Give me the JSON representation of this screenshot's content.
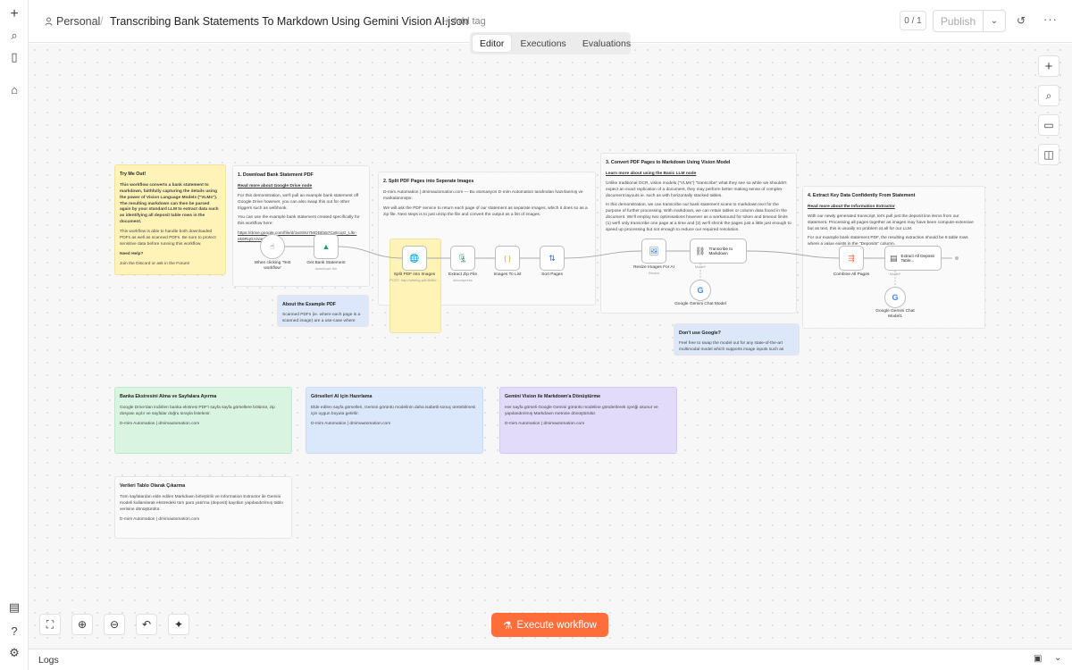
{
  "rail": {
    "add_icon": "+",
    "search_icon": "⌕",
    "panel_icon": "▯",
    "home_icon": "⌂",
    "insights_icon": "▤",
    "help_icon": "?",
    "settings_icon": "⚙"
  },
  "header": {
    "project": "Personal",
    "separator": "/",
    "workflow_title": "Transcribing Bank Statements To Markdown Using Gemini Vision AI.json",
    "add_tag": "+ Add tag",
    "counter": "0 / 1",
    "publish_label": "Publish",
    "publish_caret": "⌄",
    "history_icon": "↺",
    "more_icon": "···"
  },
  "tabs": [
    {
      "label": "Editor",
      "active": true
    },
    {
      "label": "Executions",
      "active": false
    },
    {
      "label": "Evaluations",
      "active": false
    }
  ],
  "canvas_tools": {
    "add_node_icon": "+",
    "search_icon": "⌕",
    "sticky_icon": "▭",
    "panel_icon": "◫"
  },
  "stickies": {
    "try_me": {
      "heading": "Try Me Out!",
      "body1": "This workflow converts a bank statement to markdown, faithfully capturing the details using the power of Vision Language Models (\"VLMs\"). The resulting markdown can then be parsed again by your standard LLM to extract data such as identifying all deposit table rows in the document.",
      "body2": "This workflow is able to handle both downloaded PDFs as well as scanned PDFs. Be sure to protect sensitive data before running this workflow.",
      "help_heading": "Need Help?",
      "help_body": "Join the Discord or ask in the Forum!"
    },
    "download": {
      "heading": "1. Download Bank Statement PDF",
      "link": "Read more about Google Drive node",
      "body1": "For this demonstration, we'll pull an example bank statement off Google Drive however, you can also swap this out for other triggers such as webhook.",
      "body2": "You can use the example bank statement created specifically for this workflow here:",
      "url": "https://drive.google.com/file/d/1wS9U7MQDthj57CvEcqG_Llkr-ek6RqGA/view"
    },
    "split": {
      "heading": "2. Split PDF Pages into Seperate Images",
      "body1": "D-mim Automation | dmimautomation.com — Bu otomasyon D-mim Automation tarafından hazırlanmış ve markalanmıştır.",
      "body2": "We will ask the PDF service to return each page of our statement as separate images, which it does so as a zip file. Next steps is to just unzip the file and convert the output as a list of images."
    },
    "convert": {
      "heading": "3. Convert PDF Pages to Markdown Using Vision Model",
      "link": "Learn more about using the Basic LLM node",
      "body1": "Unlike traditional OCR, vision models (\"VLMs\") \"transcribe\" what they see so while we shouldn't expect an exact replication of a document, they may perform better making sense of complex document layouts ie. such as with horizontally stacked tables.",
      "body2": "In this demonstration, we can transcribe our bank statement scans to markdown text for the purpose of further processing. With markdown, we can retain tables or column data found in the document. We'll employ two optimisations however as a workaround for token and timeout limits (1) we'll only transcribe one page at a time and (2) we'll shrink the pages just a little just enough to speed up processing but not enough to reduce our required resolution."
    },
    "extract": {
      "heading": "4. Extract Key Data Confidently From Statement",
      "link": "Read more about the Information Extractor",
      "body1": "With our newly generated transcript, let's pull just the deposit line items from our statement. Processing all pages together as images may have been compute-extensive but as text, this is usually no problem at all for our LLM.",
      "body2": "For our example bank statement PDF, the resulting extraction should be 8 table rows where a value exists in the \"Deposits\" column."
    },
    "about_pdf": {
      "heading": "About the Example PDF",
      "body": "Scanned PDFs (ie. where each page is a scanned image) are a use-case where"
    },
    "dont_google": {
      "heading": "Don't use Google?",
      "body": "Feel free to swap the model out for any state-of-the-art multimodal model which supports image inputs such as"
    },
    "tr1": {
      "heading": "Banka Ekstresini Alma ve Sayfalara Ayırma",
      "body": "Google Drive'dan indirilen banka ekstresi PDF'i sayfa sayfa görsellere bölünür, zip dosyası açılır ve sayfalar doğru sırayla listelenir.",
      "brand": "D-mim Automation | dmimautomation.com"
    },
    "tr2": {
      "heading": "Görselleri AI için Hazırlama",
      "body": "Elde edilen sayfa görselleri, Gemini görüntü modelinin daha isabetli sonuç üretebilmesi için uygun boyuta getirilir.",
      "brand": "D-mim Automation | dmimautomation.com"
    },
    "tr3": {
      "heading": "Gemini Vision ile Markdown'a Dönüştürme",
      "body": "Her sayfa görseli Google Gemini görüntü modeline gönderilerek içeriği okunur ve yapılandırılmış Markdown metnine dönüştürülür.",
      "brand": "D-mim Automation | dmimautomation.com"
    },
    "tr4": {
      "heading": "Verileri Tablo Olarak Çıkarma",
      "body": "Tüm sayfalardan elde edilen Markdown birleştirilir ve Information Extractor ile Gemini modeli kullanılarak ekstredeki tüm para yatırma (deposit) kayıtları yapılandırılmış tablo verisine dönüştürülür.",
      "brand": "D-mim Automation | dmimautomation.com"
    }
  },
  "nodes": {
    "trigger": {
      "label": "When clicking 'Test workflow'",
      "icon": "☝"
    },
    "gdrive": {
      "label": "Get Bank Statement",
      "sub": "download: file",
      "icon": "▲"
    },
    "split_pdf": {
      "label": "Split PDF into Images",
      "sub": "POST: http://stirling-pdf:8080/...",
      "icon": "🌐"
    },
    "zip": {
      "label": "Extract Zip File",
      "sub": "decompress",
      "icon": "🗜"
    },
    "list": {
      "label": "Images To List",
      "icon": "{ }"
    },
    "sort": {
      "label": "Sort Pages",
      "icon": "⇅"
    },
    "resize": {
      "label": "Resize Images For AI",
      "sub": "Resize",
      "icon": "🖼"
    },
    "transcribe": {
      "label": "Transcribe to Markdown",
      "icon": "⛓",
      "model_port": "Model*"
    },
    "gemini1": {
      "label": "Google Gemini Chat Model",
      "icon": "G"
    },
    "combine": {
      "label": "Combine All Pages",
      "icon": "⇶"
    },
    "extractor": {
      "label": "Extract All Deposit Table...",
      "icon": "▤",
      "model_port": "Model*"
    },
    "gemini2": {
      "label": "Google Gemini Chat Model1",
      "icon": "G"
    }
  },
  "bottom_tools": {
    "fit_icon": "⛶",
    "zoom_in_icon": "⊕",
    "zoom_out_icon": "⊖",
    "undo_icon": "↶",
    "tidy_icon": "✦"
  },
  "execute": {
    "icon": "⚗",
    "label": "Execute workflow"
  },
  "logs": {
    "label": "Logs",
    "icon1": "▣",
    "icon2": "⌄"
  }
}
